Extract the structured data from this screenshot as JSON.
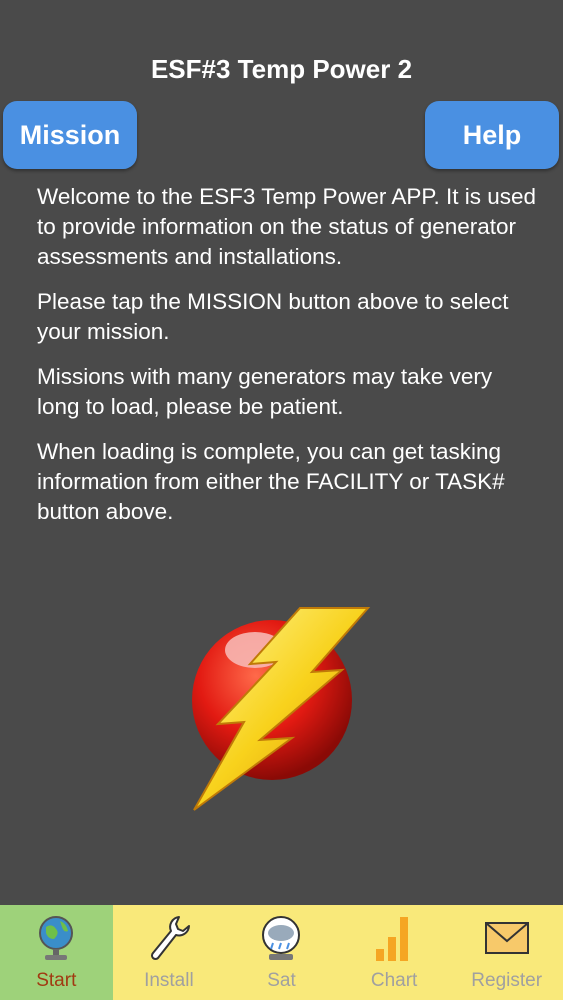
{
  "header": {
    "title": "ESF#3 Temp Power 2"
  },
  "buttons": {
    "mission": "Mission",
    "help": "Help"
  },
  "intro": {
    "paragraphs": [
      "Welcome to the ESF3 Temp Power APP.  It is used to provide information on the status of generator assessments and installations.",
      "Please tap the MISSION button above to select your mission.",
      "Missions with many generators may take very long to load, please be patient.",
      "When loading is complete, you can get tasking information from either the FACILITY or TASK# button above."
    ]
  },
  "logo": {
    "icon": "lightning-bolt-logo"
  },
  "tabs": [
    {
      "label": "Start",
      "icon": "globe-icon",
      "active": true
    },
    {
      "label": "Install",
      "icon": "wrench-icon",
      "active": false
    },
    {
      "label": "Sat",
      "icon": "weather-icon",
      "active": false
    },
    {
      "label": "Chart",
      "icon": "bar-chart-icon",
      "active": false
    },
    {
      "label": "Register",
      "icon": "envelope-icon",
      "active": false
    }
  ],
  "colors": {
    "background": "#4a4a4a",
    "button": "#4a90e2",
    "tabbar": "#f9e97a",
    "tab_active": "#9ed27a"
  }
}
